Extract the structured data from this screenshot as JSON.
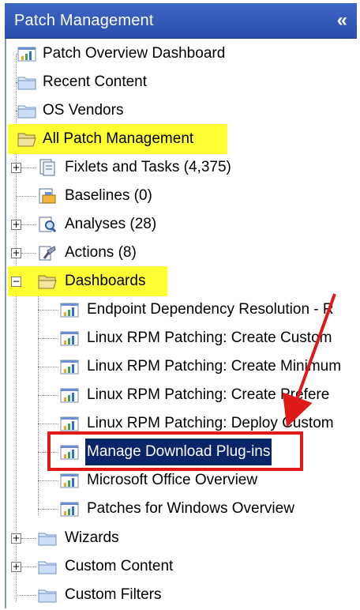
{
  "panel": {
    "title": "Patch Management",
    "collapse_glyph": "«"
  },
  "tree": {
    "root_items": [
      {
        "label": "Patch Overview Dashboard",
        "icon": "dashboard-icon"
      },
      {
        "label": "Recent Content",
        "icon": "folder-icon"
      },
      {
        "label": "OS Vendors",
        "icon": "folder-icon"
      },
      {
        "label": "All Patch Management",
        "icon": "folder-open-icon",
        "highlighted": true
      }
    ],
    "child_items": [
      {
        "label": "Fixlets and Tasks (4,375)",
        "icon": "fixlets-icon",
        "expander": "+"
      },
      {
        "label": "Baselines (0)",
        "icon": "baseline-icon"
      },
      {
        "label": "Analyses (28)",
        "icon": "analysis-icon",
        "expander": "+"
      },
      {
        "label": "Actions (8)",
        "icon": "action-icon",
        "expander": "+"
      },
      {
        "label": "Dashboards",
        "icon": "folder-open-icon",
        "expander": "−",
        "highlighted": true
      }
    ],
    "dashboard_items": [
      {
        "label": "Endpoint Dependency Resolution - R"
      },
      {
        "label": "Linux RPM Patching: Create Custom"
      },
      {
        "label": "Linux RPM Patching: Create Minimum"
      },
      {
        "label": "Linux RPM Patching: Create Prefere"
      },
      {
        "label": "Linux RPM Patching: Deploy Custom"
      },
      {
        "label": "Manage Download Plug-ins",
        "selected": true
      },
      {
        "label": "Microsoft Office Overview"
      },
      {
        "label": "Patches for Windows Overview"
      }
    ],
    "bottom_items": [
      {
        "label": "Wizards",
        "icon": "folder-icon",
        "expander": "+"
      },
      {
        "label": "Custom Content",
        "icon": "folder-icon",
        "expander": "+"
      },
      {
        "label": "Custom Filters",
        "icon": "folder-icon"
      }
    ]
  },
  "colors": {
    "header": "#2a4fae",
    "highlight": "#ffff33",
    "selection": "#0a246a",
    "annotation": "#e01919"
  }
}
